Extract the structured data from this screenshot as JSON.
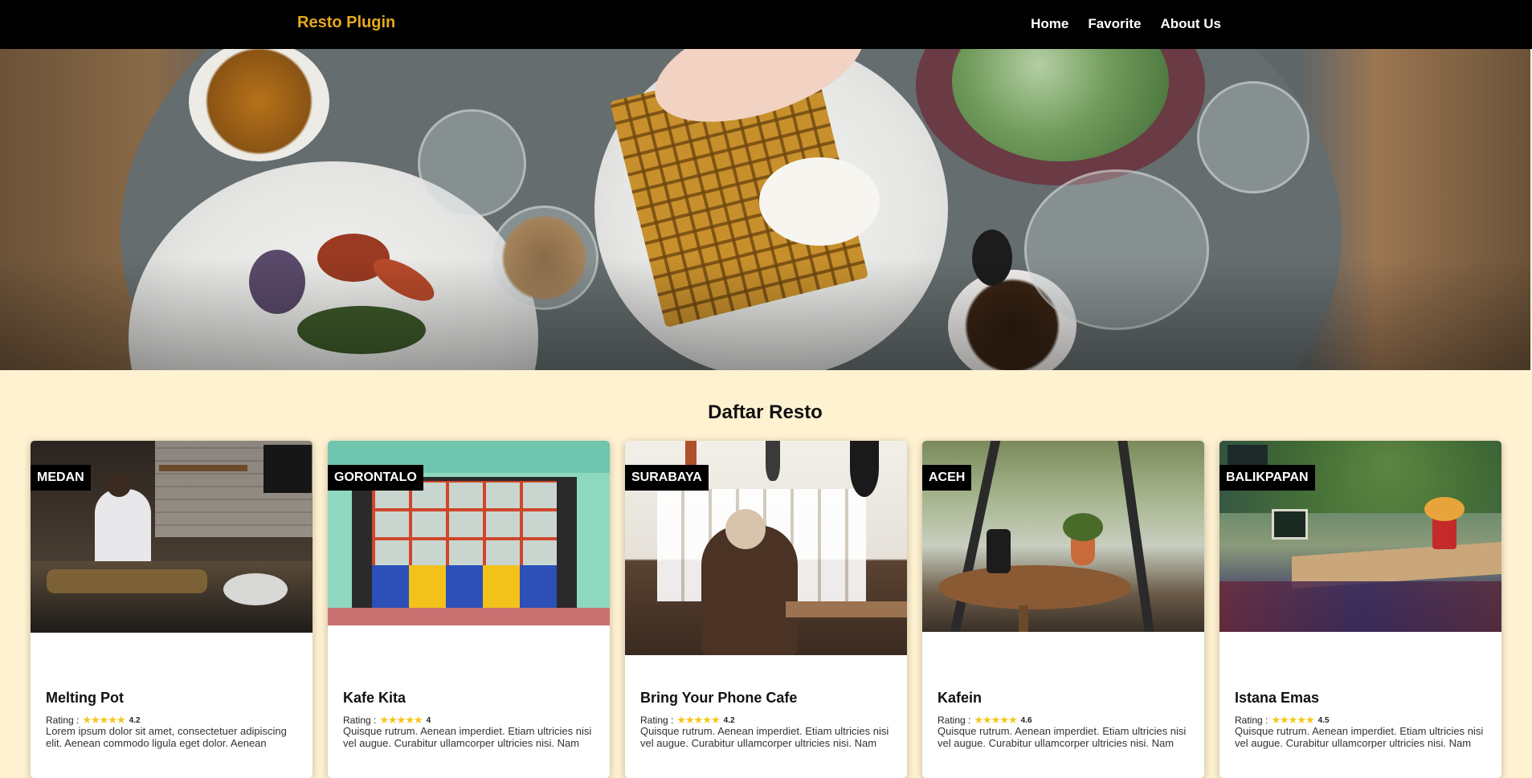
{
  "nav": {
    "brand": "Resto Plugin",
    "items": [
      {
        "label": "Home"
      },
      {
        "label": "Favorite"
      },
      {
        "label": "About Us"
      }
    ]
  },
  "section": {
    "title": "Daftar Resto"
  },
  "rating_label": "Rating :",
  "star_glyphs": "★★★★★",
  "restaurants": [
    {
      "city": "MEDAN",
      "name": "Melting Pot",
      "rating": "4.2",
      "description": "Lorem ipsum dolor sit amet, consectetuer adipiscing elit. Aenean commodo ligula eget dolor. Aenean"
    },
    {
      "city": "GORONTALO",
      "name": "Kafe Kita",
      "rating": "4",
      "description": "Quisque rutrum. Aenean imperdiet. Etiam ultricies nisi vel augue. Curabitur ullamcorper ultricies nisi. Nam"
    },
    {
      "city": "SURABAYA",
      "name": "Bring Your Phone Cafe",
      "rating": "4.2",
      "description": "Quisque rutrum. Aenean imperdiet. Etiam ultricies nisi vel augue. Curabitur ullamcorper ultricies nisi. Nam"
    },
    {
      "city": "ACEH",
      "name": "Kafein",
      "rating": "4.6",
      "description": "Quisque rutrum. Aenean imperdiet. Etiam ultricies nisi vel augue. Curabitur ullamcorper ultricies nisi. Nam"
    },
    {
      "city": "BALIKPAPAN",
      "name": "Istana Emas",
      "rating": "4.5",
      "description": "Quisque rutrum. Aenean imperdiet. Etiam ultricies nisi vel augue. Curabitur ullamcorper ultricies nisi. Nam"
    }
  ],
  "colors": {
    "brand": "#e6a91f",
    "nav_bg": "#000000",
    "page_bg": "#fff2d1",
    "star": "#f5c518"
  }
}
